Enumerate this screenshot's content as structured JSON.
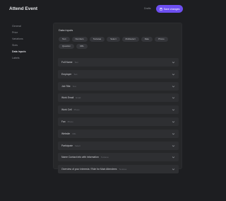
{
  "header": {
    "title": "Attend Event",
    "draft_label": "Drafts",
    "save_label": "Save changes",
    "accent": "#6d4ff0"
  },
  "sidebar": {
    "items": [
      {
        "label": "General",
        "active": false
      },
      {
        "label": "Price",
        "active": false
      },
      {
        "label": "Variations",
        "active": false
      },
      {
        "label": "Slots",
        "active": false
      },
      {
        "label": "Data inputs",
        "active": true
      },
      {
        "label": "Labels",
        "active": false
      }
    ]
  },
  "panel": {
    "title": "Data inputs",
    "chips": [
      "Text",
      "Numbers",
      "Textarea",
      "Select",
      "Multiselect",
      "Date",
      "Phone",
      "Question",
      "URL"
    ],
    "rows": [
      {
        "label": "Full Name",
        "type": "Text"
      },
      {
        "label": "Employer",
        "type": "Text"
      },
      {
        "label": "Job Title",
        "type": "Text"
      },
      {
        "label": "Work Email",
        "type": "Email"
      },
      {
        "label": "Work Cell",
        "type": "Phone"
      },
      {
        "label": "Fax",
        "type": "Phone"
      },
      {
        "label": "Website",
        "type": "URL"
      },
      {
        "label": "Participate",
        "type": "Select"
      },
      {
        "label": "Name Contact info with information",
        "type": "Textarea"
      },
      {
        "label": "Overview of your Interests / Role for Main Attendees",
        "type": "Textarea"
      }
    ]
  }
}
